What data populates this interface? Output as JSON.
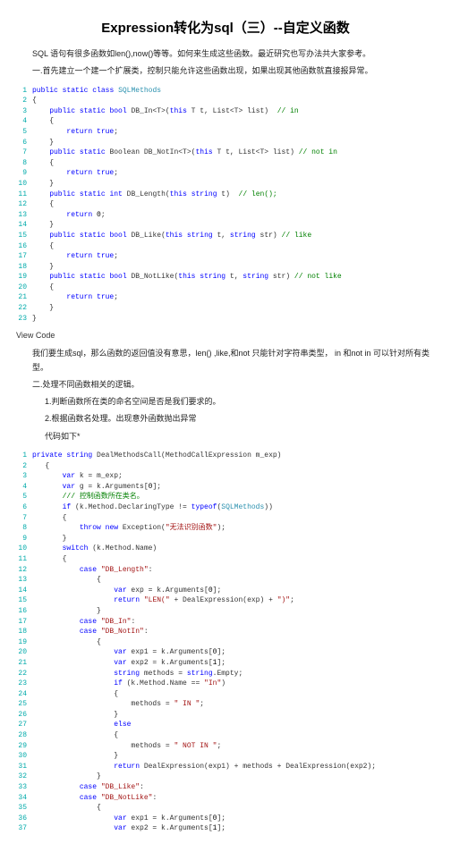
{
  "title": "Expression转化为sql（三）--自定义函数",
  "intro": "SQL 语句有很多函数如len(),now()等等。如何来生成这些函数。最近研究也写办法共大家参考。",
  "step1": "一.首先建立一个建一个扩展类，控制只能允许这些函数出现，如果出现其他函数就直接报异常。",
  "code1": [
    {
      "n": 1,
      "html": "<span class='kw'>public</span> <span class='kw'>static</span> <span class='kw'>class</span> <span class='type'>SQLMethods</span>"
    },
    {
      "n": 2,
      "html": "{"
    },
    {
      "n": 3,
      "html": "    <span class='kw'>public</span> <span class='kw'>static</span> <span class='kw'>bool</span> DB_In&lt;T&gt;(<span class='kw'>this</span> T t, List&lt;T&gt; list)  <span class='cmt'>// in</span>"
    },
    {
      "n": 4,
      "html": "    {"
    },
    {
      "n": 5,
      "html": "        <span class='kw'>return</span> <span class='kw'>true</span>;"
    },
    {
      "n": 6,
      "html": "    }"
    },
    {
      "n": 7,
      "html": "    <span class='kw'>public</span> <span class='kw'>static</span> Boolean DB_NotIn&lt;T&gt;(<span class='kw'>this</span> T t, List&lt;T&gt; list) <span class='cmt'>// not in</span>"
    },
    {
      "n": 8,
      "html": "    {"
    },
    {
      "n": 9,
      "html": "        <span class='kw'>return</span> <span class='kw'>true</span>;"
    },
    {
      "n": 10,
      "html": "    }"
    },
    {
      "n": 11,
      "html": "    <span class='kw'>public</span> <span class='kw'>static</span> <span class='kw'>int</span> DB_Length(<span class='kw'>this</span> <span class='kw'>string</span> t)  <span class='cmt'>// len();</span>"
    },
    {
      "n": 12,
      "html": "    {"
    },
    {
      "n": 13,
      "html": "        <span class='kw'>return</span> <span class='plain'>0</span>;"
    },
    {
      "n": 14,
      "html": "    }"
    },
    {
      "n": 15,
      "html": "    <span class='kw'>public</span> <span class='kw'>static</span> <span class='kw'>bool</span> DB_Like(<span class='kw'>this</span> <span class='kw'>string</span> t, <span class='kw'>string</span> str) <span class='cmt'>// like</span>"
    },
    {
      "n": 16,
      "html": "    {"
    },
    {
      "n": 17,
      "html": "        <span class='kw'>return</span> <span class='kw'>true</span>;"
    },
    {
      "n": 18,
      "html": "    }"
    },
    {
      "n": 19,
      "html": "    <span class='kw'>public</span> <span class='kw'>static</span> <span class='kw'>bool</span> DB_NotLike(<span class='kw'>this</span> <span class='kw'>string</span> t, <span class='kw'>string</span> str) <span class='cmt'>// not like</span>"
    },
    {
      "n": 20,
      "html": "    {"
    },
    {
      "n": 21,
      "html": "        <span class='kw'>return</span> <span class='kw'>true</span>;"
    },
    {
      "n": 22,
      "html": "    }"
    },
    {
      "n": 23,
      "html": "}"
    }
  ],
  "viewcode": "View Code",
  "mid1": "我们要生成sql，那么函数的返回值没有意思，len() ,like,和not 只能针对字符串类型， in 和not in 可以针对所有类型。",
  "mid2": "二.处理不同函数相关的逻辑。",
  "mid3": "1.判断函数所在类的命名空间是否是我们要求的。",
  "mid4": "2.根据函数名处理。出现意外函数抛出异常",
  "mid5": "代码如下*",
  "code2": [
    {
      "n": 1,
      "html": "<span class='kw'>private</span> <span class='kw'>string</span> DealMethodsCall(MethodCallExpression m_exp)"
    },
    {
      "n": 2,
      "html": "   {"
    },
    {
      "n": 3,
      "html": "       <span class='kw'>var</span> k = m_exp;"
    },
    {
      "n": 4,
      "html": "       <span class='kw'>var</span> g = k.Arguments[<span class='plain'>0</span>];"
    },
    {
      "n": 5,
      "html": "       <span class='cmt'>/// 控制函数所在类名。</span>"
    },
    {
      "n": 6,
      "html": "       <span class='kw'>if</span> (k.Method.DeclaringType != <span class='kw'>typeof</span>(<span class='type'>SQLMethods</span>))"
    },
    {
      "n": 7,
      "html": "       {"
    },
    {
      "n": 8,
      "html": "           <span class='kw'>throw</span> <span class='kw'>new</span> Exception(<span class='str'>\"无法识别函数\"</span>);"
    },
    {
      "n": 9,
      "html": "       }"
    },
    {
      "n": 10,
      "html": "       <span class='kw'>switch</span> (k.Method.Name)"
    },
    {
      "n": 11,
      "html": "       {"
    },
    {
      "n": 12,
      "html": "           <span class='kw'>case</span> <span class='str'>\"DB_Length\"</span>:"
    },
    {
      "n": 13,
      "html": "               {"
    },
    {
      "n": 14,
      "html": "                   <span class='kw'>var</span> exp = k.Arguments[<span class='plain'>0</span>];"
    },
    {
      "n": 15,
      "html": "                   <span class='kw'>return</span> <span class='str'>\"LEN(\"</span> + DealExpression(exp) + <span class='str'>\")\"</span>;"
    },
    {
      "n": 16,
      "html": "               }"
    },
    {
      "n": 17,
      "html": "           <span class='kw'>case</span> <span class='str'>\"DB_In\"</span>:"
    },
    {
      "n": 18,
      "html": "           <span class='kw'>case</span> <span class='str'>\"DB_NotIn\"</span>:"
    },
    {
      "n": 19,
      "html": "               {"
    },
    {
      "n": 20,
      "html": "                   <span class='kw'>var</span> exp1 = k.Arguments[<span class='plain'>0</span>];"
    },
    {
      "n": 21,
      "html": "                   <span class='kw'>var</span> exp2 = k.Arguments[<span class='plain'>1</span>];"
    },
    {
      "n": 22,
      "html": "                   <span class='kw'>string</span> methods = <span class='kw'>string</span>.Empty;"
    },
    {
      "n": 23,
      "html": "                   <span class='kw'>if</span> (k.Method.Name == <span class='str'>\"In\"</span>)"
    },
    {
      "n": 24,
      "html": "                   {"
    },
    {
      "n": 25,
      "html": "                       methods = <span class='str'>\" IN \"</span>;"
    },
    {
      "n": 26,
      "html": "                   }"
    },
    {
      "n": 27,
      "html": "                   <span class='kw'>else</span>"
    },
    {
      "n": 28,
      "html": "                   {"
    },
    {
      "n": 29,
      "html": "                       methods = <span class='str'>\" NOT IN \"</span>;"
    },
    {
      "n": 30,
      "html": "                   }"
    },
    {
      "n": 31,
      "html": "                   <span class='kw'>return</span> DealExpression(exp1) + methods + DealExpression(exp2);"
    },
    {
      "n": 32,
      "html": "               }"
    },
    {
      "n": 33,
      "html": "           <span class='kw'>case</span> <span class='str'>\"DB_Like\"</span>:"
    },
    {
      "n": 34,
      "html": "           <span class='kw'>case</span> <span class='str'>\"DB_NotLike\"</span>:"
    },
    {
      "n": 35,
      "html": "               {"
    },
    {
      "n": 36,
      "html": "                   <span class='kw'>var</span> exp1 = k.Arguments[<span class='plain'>0</span>];"
    },
    {
      "n": 37,
      "html": "                   <span class='kw'>var</span> exp2 = k.Arguments[<span class='plain'>1</span>];"
    }
  ]
}
